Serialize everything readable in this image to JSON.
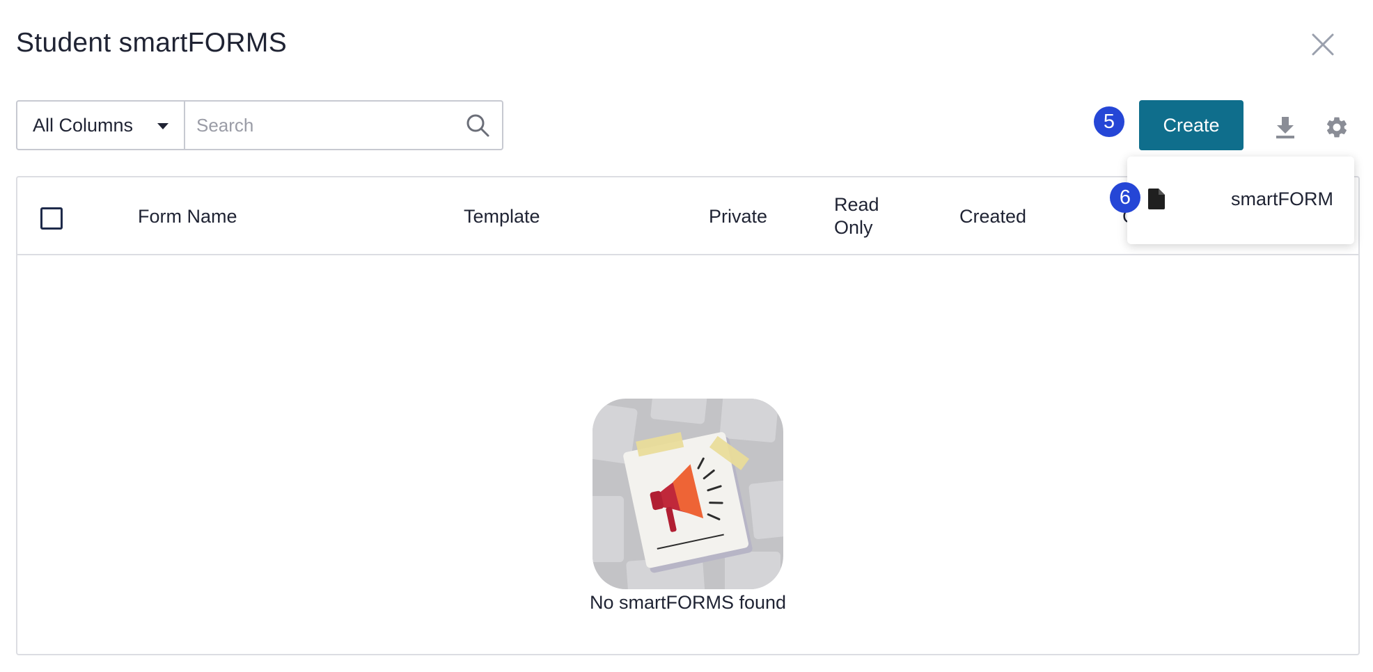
{
  "header": {
    "title": "Student smartFORMS",
    "close_icon": "close-icon"
  },
  "search": {
    "column_selected": "All Columns",
    "placeholder": "Search",
    "value": "",
    "search_icon": "search-icon"
  },
  "toolbar": {
    "create_label": "Create",
    "create_step": "5",
    "download_icon": "download-icon",
    "settings_icon": "gear-icon"
  },
  "create_menu": {
    "step": "6",
    "items": [
      {
        "label": "smartFORM",
        "icon": "document-icon"
      }
    ]
  },
  "table": {
    "columns": [
      "Form Name",
      "Template",
      "Private",
      "Read Only",
      "Created",
      "C"
    ],
    "rows": []
  },
  "empty_state": {
    "message": "No smartFORMS found",
    "icon": "megaphone-illustration"
  },
  "colors": {
    "primary_button": "#0f6e8c",
    "step_badge": "#2546d6",
    "text": "#1f2333",
    "border": "#c7c9d1"
  }
}
